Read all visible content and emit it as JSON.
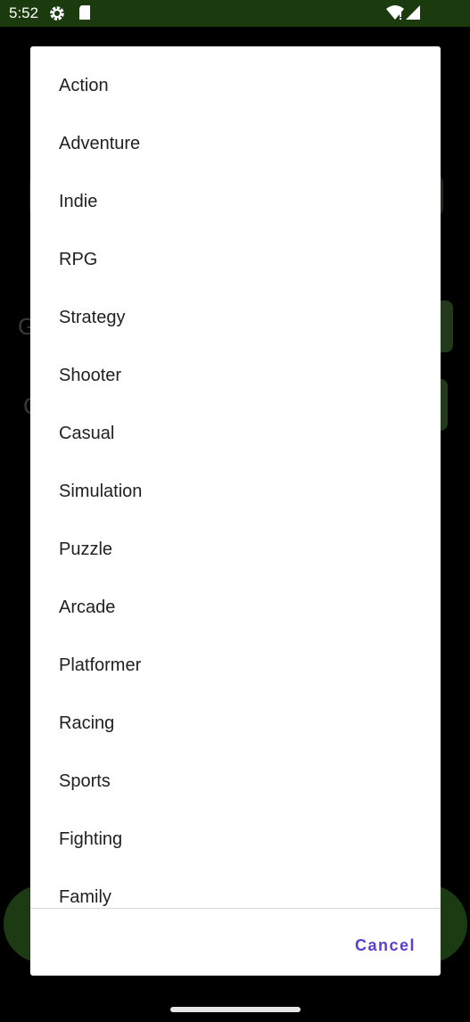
{
  "status_bar": {
    "time": "5:52",
    "background_color": "#1b3a0d",
    "icons": [
      "gear-icon",
      "sd-card-icon",
      "wifi-icon",
      "signal-icon"
    ]
  },
  "background_app": {
    "letter_1": "G",
    "letter_2": "C",
    "accent_color": "#1c3b12"
  },
  "dialog": {
    "items": [
      "Action",
      "Adventure",
      "Indie",
      "RPG",
      "Strategy",
      "Shooter",
      "Casual",
      "Simulation",
      "Puzzle",
      "Arcade",
      "Platformer",
      "Racing",
      "Sports",
      "Fighting",
      "Family"
    ],
    "cancel_label": "Cancel",
    "cancel_color": "#5a3fd0"
  }
}
